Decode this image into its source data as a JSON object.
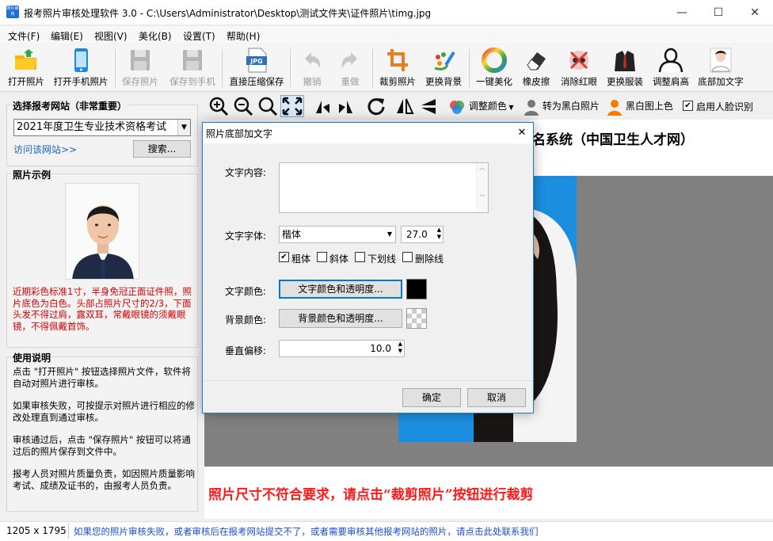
{
  "window": {
    "icon_text": "照片审核",
    "title": "报考照片审核处理软件 3.0 - C:\\Users\\Administrator\\Desktop\\测试文件夹\\证件照片\\timg.jpg",
    "minimize": "—",
    "maximize": "☐",
    "close": "✕"
  },
  "menu": [
    "文件(F)",
    "编辑(E)",
    "视图(V)",
    "美化(B)",
    "设置(T)",
    "帮助(H)"
  ],
  "toolbar": [
    {
      "label": "打开照片",
      "icon": "folder-open-icon",
      "enabled": true
    },
    {
      "label": "打开手机照片",
      "icon": "phone-icon",
      "enabled": true
    },
    {
      "label": "保存照片",
      "icon": "save-icon",
      "enabled": false
    },
    {
      "label": "保存到手机",
      "icon": "save-to-phone-icon",
      "enabled": false
    },
    {
      "label": "直接压缩保存",
      "icon": "jpg-compress-icon",
      "enabled": true
    },
    {
      "label": "撤销",
      "icon": "undo-icon",
      "enabled": false
    },
    {
      "label": "重做",
      "icon": "redo-icon",
      "enabled": false
    },
    {
      "label": "裁剪照片",
      "icon": "crop-icon",
      "enabled": true
    },
    {
      "label": "更换背景",
      "icon": "change-background-icon",
      "enabled": true
    },
    {
      "label": "一键美化",
      "icon": "color-wheel-icon",
      "enabled": true
    },
    {
      "label": "橡皮擦",
      "icon": "eraser-icon",
      "enabled": true
    },
    {
      "label": "消除红眼",
      "icon": "red-eye-icon",
      "enabled": true
    },
    {
      "label": "更换服装",
      "icon": "suit-icon",
      "enabled": true
    },
    {
      "label": "调整肩高",
      "icon": "shoulder-icon",
      "enabled": true
    },
    {
      "label": "底部加文字",
      "icon": "portrait-text-icon",
      "enabled": true
    }
  ],
  "left_panel": {
    "site_group_title": "选择报考网站（非常重要）",
    "site_select_value": "2021年度卫生专业技术资格考试",
    "visit_link": "访问该网站>>",
    "search_button": "搜索...",
    "example_group_title": "照片示例",
    "example_requirements": "近期彩色标准1寸，半身免冠正面证件照，照片底色为白色。头部占照片尺寸的2/3，下面头发不得过肩，露双耳，常戴眼镜的须戴眼镜，不得佩戴首饰。",
    "usage_group_title": "使用说明",
    "usage_paragraphs": [
      "点击 \"打开照片\" 按钮选择照片文件，软件将自动对照片进行审核。",
      "如果审核失败，可按提示对照片进行相应的修改处理直到通过审核。",
      "审核通过后，点击 \"保存照片\" 按钮可以将通过后的照片保存到文件中。",
      "报考人员对照片质量负责，如因照片质量影响考试、成绩及证书的，由报考人员负责。"
    ]
  },
  "image_toolbar": {
    "adjust_color": "调整颜色",
    "to_bw": "转为黑白照片",
    "bw_colorize": "黑白图上色",
    "face_detect_label": "启用人脸识别",
    "face_detect_checked": true
  },
  "canvas": {
    "header_text": "名系统（中国卫生人才网）",
    "error_message": "照片尺寸不符合要求，请点击“裁剪照片”按钮进行裁剪",
    "photo_bg_color": "#1b8ee0"
  },
  "dialog": {
    "title": "照片底部加文字",
    "close": "✕",
    "content_label": "文字内容:",
    "content_value": "",
    "font_label": "文字字体:",
    "font_value": "楷体",
    "font_size": "27.0",
    "bold_label": "粗体",
    "bold_checked": true,
    "italic_label": "斜体",
    "underline_label": "下划线",
    "strike_label": "删除线",
    "text_color_label": "文字颜色:",
    "text_color_button": "文字颜色和透明度...",
    "text_color_value": "#000000",
    "bg_color_label": "背景颜色:",
    "bg_color_button": "背景颜色和透明度...",
    "offset_label": "垂直偏移:",
    "offset_value": "10.0",
    "ok": "确定",
    "cancel": "取消"
  },
  "status": {
    "size": "1205 x 1795",
    "message": "如果您的照片审核失败，或者审核后在报考网站提交不了，或者需要审核其他报考网站的照片，请点击此处联系我们"
  }
}
